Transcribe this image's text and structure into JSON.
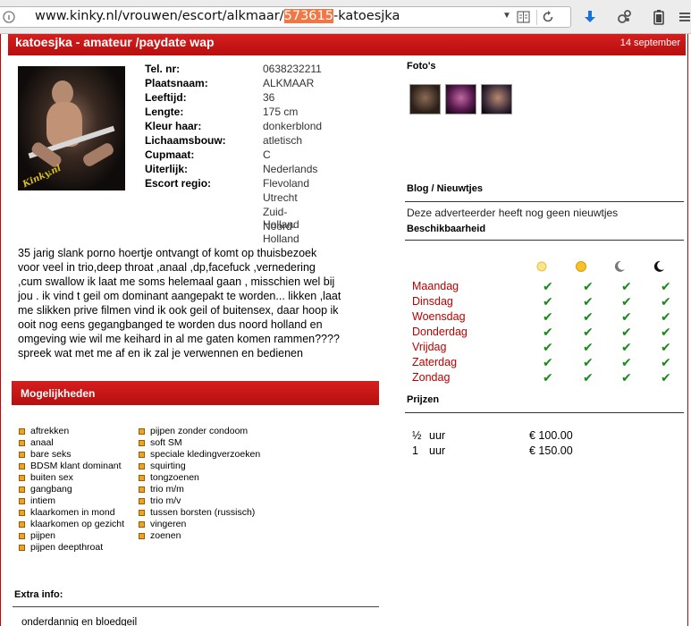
{
  "browser": {
    "url_prefix": "www.kinky.nl/vrouwen/escort/alkmaar/",
    "url_highlight": "573615",
    "url_suffix": "-katoesjka",
    "icons": [
      "site-identity-icon",
      "dropdown-icon",
      "reader-view-icon",
      "reload-icon",
      "download-icon",
      "extension-icon",
      "battery-icon",
      "menu-icon"
    ]
  },
  "ad": {
    "title": "katoesjka - amateur /paydate wap",
    "date": "14 september",
    "photo_watermark": "Kinky.nl",
    "details": [
      {
        "label": "Tel. nr:",
        "value": "0638232211"
      },
      {
        "label": "Plaatsnaam:",
        "value": "ALKMAAR"
      },
      {
        "label": "Leeftijd:",
        "value": "36"
      },
      {
        "label": "Lengte:",
        "value": "175 cm"
      },
      {
        "label": "Kleur haar:",
        "value": "donkerblond"
      },
      {
        "label": "Lichaamsbouw:",
        "value": "atletisch"
      },
      {
        "label": "Cupmaat:",
        "value": "C"
      },
      {
        "label": "Uiterlijk:",
        "value": "Nederlands"
      },
      {
        "label": "Escort regio:",
        "value": "Flevoland"
      }
    ],
    "regions_extra": [
      "Utrecht",
      "Zuid-Holland",
      "Noord-Holland"
    ],
    "description": "35 jarig slank porno hoertje ontvangt of komt op thuisbezoek voor veel in trio,deep throat ,anaal ,dp,facefuck ,vernedering ,cum swallow ik laat me soms helemaal gaan , misschien wel bij jou . ik vind t geil om dominant aangepakt te worden... likken ,laat me slikken prive filmen vind ik ook geil of buitensex, daar hoop ik ooit nog eens gegangbanged te worden dus noord holland en omgeving wie wil me keihard in al me gaten komen rammen???? spreek wat met me af en ik zal je verwennen en bedienen",
    "possibilities_title": "Mogelijkheden",
    "possibilities_col1": [
      "aftrekken",
      "anaal",
      "bare seks",
      "BDSM klant dominant",
      "buiten sex",
      "gangbang",
      "intiem",
      "klaarkomen in mond",
      "klaarkomen op gezicht",
      "pijpen",
      "pijpen deepthroat"
    ],
    "possibilities_col2": [
      "pijpen zonder condoom",
      "soft SM",
      "speciale kledingverzoeken",
      "squirting",
      "tongzoenen",
      "trio m/m",
      "trio m/v",
      "tussen borsten (russisch)",
      "vingeren",
      "zoenen"
    ],
    "extra_title": "Extra info:",
    "extra_text": "onderdannig en bloedgeil"
  },
  "right": {
    "photos_title": "Foto's",
    "blog_title": "Blog / Nieuwtjes",
    "blog_text": "Deze adverteerder heeft nog geen nieuwtjes",
    "avail_title": "Beschikbaarheid",
    "avail_columns": [
      "morning-sun-icon",
      "afternoon-sun-icon",
      "evening-moon-icon",
      "night-moon-icon"
    ],
    "days": [
      "Maandag",
      "Dinsdag",
      "Woensdag",
      "Donderdag",
      "Vrijdag",
      "Zaterdag",
      "Zondag"
    ],
    "checkmark": "✔",
    "prices_title": "Prijzen",
    "prices": [
      {
        "duration": "½",
        "unit": "uur",
        "amount": "€ 100.00"
      },
      {
        "duration": "1",
        "unit": "uur",
        "amount": "€ 150.00"
      }
    ]
  }
}
